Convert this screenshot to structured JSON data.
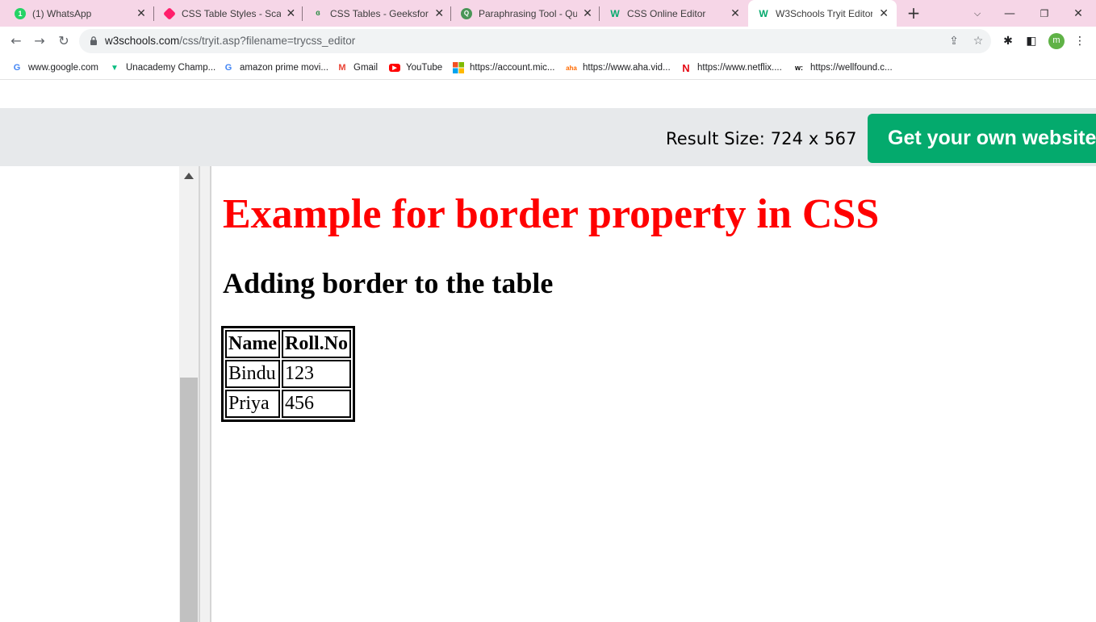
{
  "tabs": [
    {
      "title": "(1) WhatsApp",
      "icon": "whatsapp-icon",
      "color": "#25d366"
    },
    {
      "title": "CSS Table Styles - Scaler T",
      "icon": "scaler-icon",
      "color": "#ff1f6b"
    },
    {
      "title": "CSS Tables - GeeksforGee",
      "icon": "geeksforgeeks-icon",
      "color": "#2f8d46"
    },
    {
      "title": "Paraphrasing Tool - QuillB",
      "icon": "quillbot-icon",
      "color": "#499557"
    },
    {
      "title": "CSS Online Editor",
      "icon": "w3schools-icon",
      "color": "#04aa6d"
    },
    {
      "title": "W3Schools Tryit Editor",
      "icon": "w3schools-icon",
      "color": "#04aa6d"
    }
  ],
  "address_bar": {
    "domain": "w3schools.com",
    "path": "/css/tryit.asp?filename=trycss_editor"
  },
  "profile": {
    "initial": "m",
    "color": "#5fb246"
  },
  "bookmarks": [
    {
      "label": "www.google.com",
      "icon": "google-icon"
    },
    {
      "label": "Unacademy Champ...",
      "icon": "unacademy-icon"
    },
    {
      "label": "amazon prime movi...",
      "icon": "google-icon"
    },
    {
      "label": "Gmail",
      "icon": "gmail-icon"
    },
    {
      "label": "YouTube",
      "icon": "youtube-icon"
    },
    {
      "label": "https://account.mic...",
      "icon": "microsoft-icon"
    },
    {
      "label": "https://www.aha.vid...",
      "icon": "aha-icon"
    },
    {
      "label": "https://www.netflix....",
      "icon": "netflix-icon"
    },
    {
      "label": "https://wellfound.c...",
      "icon": "wellfound-icon"
    }
  ],
  "tryit": {
    "result_size": "Result Size: 724 x 567",
    "cta_label": "Get your own website",
    "accent": "#04aa6d"
  },
  "result_page": {
    "heading": "Example for border property in CSS",
    "heading_color": "#ff0000",
    "subheading": "Adding border to the table",
    "table": {
      "headers": [
        "Name",
        "Roll.No"
      ],
      "rows": [
        [
          "Bindu",
          "123"
        ],
        [
          "Priya",
          "456"
        ]
      ]
    }
  }
}
